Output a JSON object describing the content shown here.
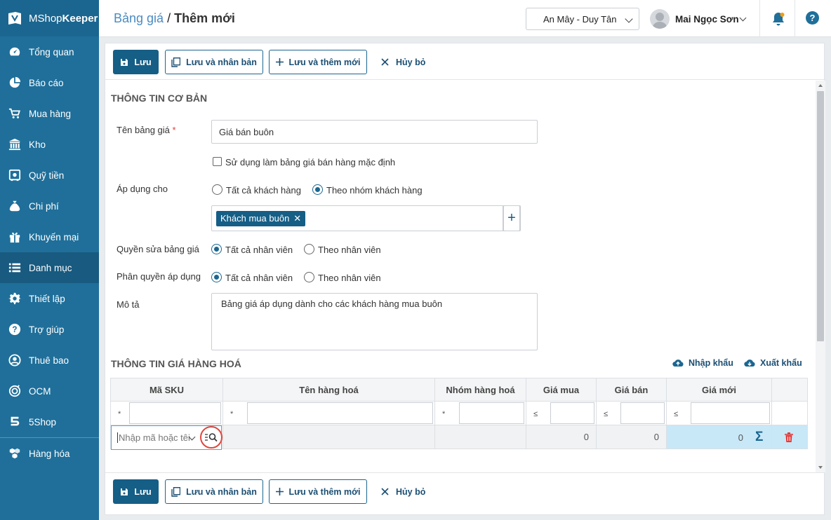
{
  "app": {
    "brand_light": "MShop",
    "brand_bold": "Keeper"
  },
  "sidebar": {
    "items": [
      {
        "label": "Tổng quan",
        "icon": "dashboard-icon"
      },
      {
        "label": "Báo cáo",
        "icon": "pie-chart-icon"
      },
      {
        "label": "Mua hàng",
        "icon": "cart-icon"
      },
      {
        "label": "Kho",
        "icon": "warehouse-icon"
      },
      {
        "label": "Quỹ tiền",
        "icon": "safe-icon"
      },
      {
        "label": "Chi phí",
        "icon": "money-bag-icon"
      },
      {
        "label": "Khuyến mại",
        "icon": "gift-icon"
      },
      {
        "label": "Danh mục",
        "icon": "list-icon",
        "active": true
      },
      {
        "label": "Thiết lập",
        "icon": "gear-icon"
      },
      {
        "label": "Trợ giúp",
        "icon": "help-icon"
      },
      {
        "label": "Thuê bao",
        "icon": "user-icon"
      },
      {
        "label": "OCM",
        "icon": "ocm-icon"
      },
      {
        "label": "5Shop",
        "icon": "5shop-icon"
      },
      {
        "label": "Hàng hóa",
        "icon": "boxes-icon"
      }
    ]
  },
  "header": {
    "breadcrumb": "Bảng giá",
    "separator": " / ",
    "title": "Thêm mới",
    "branch": "An Mây - Duy Tân",
    "user": "Mai Ngọc Sơn"
  },
  "toolbar": {
    "save": "Lưu",
    "save_copy": "Lưu và nhân bản",
    "save_new": "Lưu và thêm mới",
    "cancel": "Hủy bỏ"
  },
  "basic": {
    "section_title": "THÔNG TIN CƠ BẢN",
    "name_label": "Tên bảng giá",
    "required_mark": "*",
    "name_value": "Giá bán buôn",
    "default_checkbox": "Sử dụng làm bảng giá bán hàng mặc định",
    "apply_label": "Áp dụng cho",
    "apply_all": "Tất cả khách hàng",
    "apply_group": "Theo nhóm khách hàng",
    "group_tag": "Khách mua buôn",
    "edit_perm_label": "Quyền sửa bảng giá",
    "apply_perm_label": "Phân quyền áp dụng",
    "all_staff": "Tất cả nhân viên",
    "by_staff": "Theo nhân viên",
    "desc_label": "Mô tả",
    "desc_value": "Bảng giá áp dụng dành cho các khách hàng mua buôn"
  },
  "prices": {
    "section_title": "THÔNG TIN GIÁ HÀNG HOÁ",
    "import": "Nhập khẩu",
    "export": "Xuất khẩu",
    "columns": [
      "Mã SKU",
      "Tên hàng hoá",
      "Nhóm hàng hoá",
      "Giá mua",
      "Giá bán",
      "Giá mới"
    ],
    "filter_ops": [
      "*",
      "*",
      "*",
      "≤",
      "≤",
      "≤"
    ],
    "sku_placeholder": "Nhập mã hoặc têi",
    "row": {
      "cost": "0",
      "price": "0",
      "new_price": "0"
    }
  },
  "colors": {
    "sidebar": "#1f6f9a",
    "primary": "#155e86",
    "highlight": "#c8e8f7"
  }
}
